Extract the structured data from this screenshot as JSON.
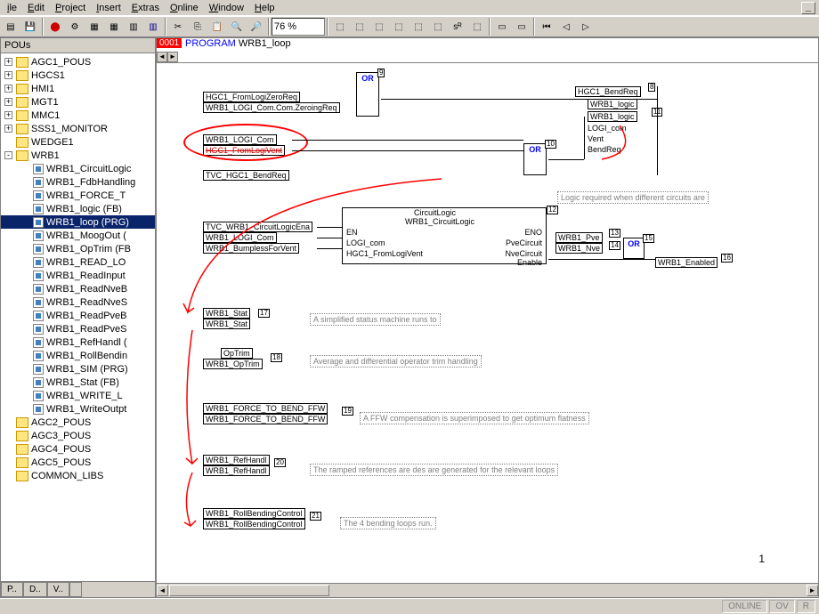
{
  "menu": [
    "ile",
    "Edit",
    "Project",
    "Insert",
    "Extras",
    "Online",
    "Window",
    "Help"
  ],
  "zoom": "76 %",
  "left_header": "POUs",
  "tree_top": [
    {
      "exp": "+",
      "label": "AGC1_POUS"
    },
    {
      "exp": "+",
      "label": "HGCS1"
    },
    {
      "exp": "+",
      "label": "HMI1"
    },
    {
      "exp": "+",
      "label": "MGT1"
    },
    {
      "exp": "+",
      "label": "MMC1"
    },
    {
      "exp": "+",
      "label": "SSS1_MONITOR"
    },
    {
      "exp": "",
      "label": "WEDGE1"
    },
    {
      "exp": "-",
      "label": "WRB1"
    }
  ],
  "tree_wrb": [
    "WRB1_CircuitLogic",
    "WRB1_FdbHandling",
    "WRB1_FORCE_T",
    "WRB1_logic (FB)",
    "WRB1_loop (PRG)",
    "WRB1_MoogOut (",
    "WRB1_OpTrim (FB",
    "WRB1_READ_LO",
    "WRB1_ReadInput",
    "WRB1_ReadNveB",
    "WRB1_ReadNveS",
    "WRB1_ReadPveB",
    "WRB1_ReadPveS",
    "WRB1_RefHandl (",
    "WRB1_RollBendin",
    "WRB1_SIM (PRG)",
    "WRB1_Stat (FB)",
    "WRB1_WRITE_L",
    "WRB1_WriteOutpt"
  ],
  "tree_bottom": [
    "AGC2_POUS",
    "AGC3_POUS",
    "AGC4_POUS",
    "AGC5_POUS",
    "COMMON_LIBS"
  ],
  "tree_selected": 4,
  "left_tabs": [
    "P..",
    "D..",
    "V..",
    ""
  ],
  "code_line": "0001",
  "prog_keyword": "PROGRAM",
  "prog_name": "WRB1_loop",
  "blocks": {
    "b1": "HGC1_FromLogiZeroReq",
    "b2": "WRB1_LOGI_Com.Com.ZeroingReq",
    "b3": "WRB1_LOGI_Com",
    "b4": "HGC1_FromLogiVent",
    "b5": "TVC_HGC1_BendReq",
    "b6": "TVC_WRB1_CircuitLogicEna",
    "b7": "WRB1_LOGI_Com",
    "b8": "WRB1_BumplessForVent",
    "b9": "HGC1_BendReq",
    "b10": "WRB1_logic",
    "b11": "WRB1_logic",
    "b12": "LOGI_com",
    "b13": "Vent",
    "b14": "BendReq",
    "b15": "WRB1_Pve",
    "b16": "WRB1_Nve",
    "b17": "WRB1_Enabled",
    "stat_t": "WRB1_Stat",
    "stat_b": "WRB1_Stat",
    "op_t": "OpTrim",
    "op_b": "WRB1_OpTrim",
    "ffw_t": "WRB1_FORCE_TO_BEND_FFW",
    "ffw_b": "WRB1_FORCE_TO_BEND_FFW",
    "ref_t": "WRB1_RefHandl",
    "ref_b": "WRB1_RefHandl",
    "roll_t": "WRB1_RollBendingControl",
    "roll_b": "WRB1_RollBendingControl",
    "cl_t": "CircuitLogic",
    "cl_b": "WRB1_CircuitLogic",
    "en": "EN",
    "eno": "ENO",
    "logi_com": "LOGI_com",
    "hgc_flv": "HGC1_FromLogiVent",
    "pve": "PveCircuit",
    "nve": "NveCircuit",
    "enable": "Enable"
  },
  "or_label": "OR",
  "comments": {
    "c1": "Logic required when different circuits are",
    "c2": "A simplified status machine runs to",
    "c3": "Average and differential operator trim handling",
    "c4": "A FFW compensation is superimposed to get optimum flatness",
    "c5": "The ramped references are des are generated for the relevant loops",
    "c6": "The 4 bending loops run."
  },
  "nums": {
    "n8": "8",
    "n9": "9",
    "n10": "10",
    "n11": "11",
    "n12": "12",
    "n13": "13",
    "n14": "14",
    "n15": "15",
    "n16": "16",
    "n17": "17",
    "n18": "18",
    "n19": "19",
    "n20": "20",
    "n21": "21"
  },
  "status": [
    "ONLINE",
    "OV",
    "R"
  ],
  "page": "1"
}
